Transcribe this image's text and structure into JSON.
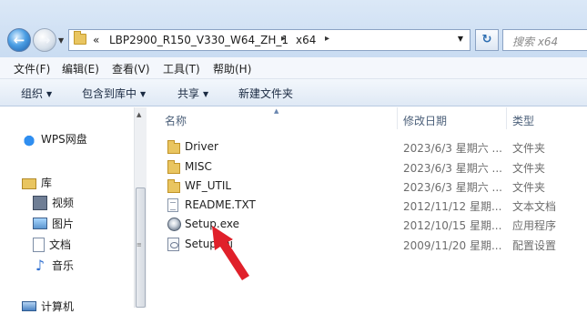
{
  "address_bar": {
    "overflow_chevron": "«",
    "breadcrumbs": [
      "LBP2900_R150_V330_W64_ZH_1",
      "x64"
    ],
    "separator": "▸",
    "search_placeholder": "搜索 x64"
  },
  "menu": [
    "文件(F)",
    "编辑(E)",
    "查看(V)",
    "工具(T)",
    "帮助(H)"
  ],
  "toolbar": {
    "organize": "组织",
    "include_in_library": "包含到库中",
    "share": "共享",
    "new_folder": "新建文件夹"
  },
  "nav": {
    "wps": "WPS网盘",
    "library": "库",
    "videos": "视频",
    "pictures": "图片",
    "documents": "文档",
    "music": "音乐",
    "computer": "计算机"
  },
  "columns": {
    "name": "名称",
    "date": "修改日期",
    "type": "类型"
  },
  "files": [
    {
      "name": "Driver",
      "date": "2023/6/3 星期六 ...",
      "type": "文件夹",
      "icon": "folder-icon"
    },
    {
      "name": "MISC",
      "date": "2023/6/3 星期六 ...",
      "type": "文件夹",
      "icon": "folder-icon"
    },
    {
      "name": "WF_UTIL",
      "date": "2023/6/3 星期六 ...",
      "type": "文件夹",
      "icon": "folder-icon"
    },
    {
      "name": "README.TXT",
      "date": "2012/11/12 星期...",
      "type": "文本文档",
      "icon": "text-file-icon"
    },
    {
      "name": "Setup.exe",
      "date": "2012/10/15 星期...",
      "type": "应用程序",
      "icon": "setup-exe-icon"
    },
    {
      "name": "Setup.ini",
      "date": "2009/11/20 星期...",
      "type": "配置设置",
      "icon": "config-file-icon"
    }
  ],
  "annotation": {
    "color": "#e0202a",
    "target": "Setup.exe"
  }
}
